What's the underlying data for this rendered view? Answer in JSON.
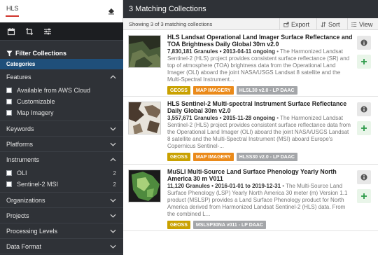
{
  "search": {
    "value": "HLS"
  },
  "filter": {
    "heading": "Filter Collections",
    "categories_label": "Categories",
    "features": {
      "label": "Features",
      "items": [
        {
          "label": "Available from AWS Cloud"
        },
        {
          "label": "Customizable"
        },
        {
          "label": "Map Imagery"
        }
      ]
    },
    "keywords_label": "Keywords",
    "platforms_label": "Platforms",
    "instruments": {
      "label": "Instruments",
      "items": [
        {
          "label": "OLI",
          "count": "2"
        },
        {
          "label": "Sentinel-2 MSI",
          "count": "2"
        }
      ]
    },
    "sections": [
      "Organizations",
      "Projects",
      "Processing Levels",
      "Data Format"
    ]
  },
  "main": {
    "title": "3 Matching Collections",
    "showing": "Showing 3 of 3 matching collections",
    "export_label": "Export",
    "sort_label": "Sort",
    "view_label": "View"
  },
  "collections": [
    {
      "title": "HLS Landsat Operational Land Imager Surface Reflectance and TOA Brightness Daily Global 30m v2.0",
      "meta": "7,830,181 Granules • 2013-04-11 ongoing",
      "desc": " • The Harmonized Landsat Sentinel-2 (HLS) project provides consistent surface reflectance (SR) and top of atmosphere (TOA) brightness data from the Operational Land Imager (OLI) aboard the joint NASA/USGS Landsat 8 satellite and the Multi-Spectral Instrument...",
      "tags": [
        "GEOSS",
        "MAP IMAGERY",
        "HLSL30 v2.0 - LP DAAC"
      ]
    },
    {
      "title": "HLS Sentinel-2 Multi-spectral Instrument Surface Reflectance Daily Global 30m v2.0",
      "meta": "3,557,671 Granules • 2015-11-28 ongoing",
      "desc": " • The Harmonized Landsat Sentinel-2 (HLS) project provides consistent surface reflectance data from the Operational Land Imager (OLI) aboard the joint NASA/USGS Landsat 8 satellite and the Multi-Spectral Instrument (MSI) aboard Europe's Copernicus Sentinel-...",
      "tags": [
        "GEOSS",
        "MAP IMAGERY",
        "HLSS30 v2.0 - LP DAAC"
      ]
    },
    {
      "title": "MuSLI Multi-Source Land Surface Phenology Yearly North America 30 m V011",
      "meta": "11,120 Granules • 2016-01-01 to 2019-12-31",
      "desc": " • The Multi-Source Land Surface Phenology (LSP) Yearly North America 30 meter (m) Version 1.1 product (MSLSP) provides a Land Surface Phenology product for North America derived from Harmonized Landsat Sentinel-2 (HLS) data. From the combined L...",
      "tags": [
        "GEOSS",
        "MSLSP30NA v011 - LP DAAC"
      ]
    }
  ],
  "colors": {
    "sidebar": "#2f3237",
    "categories": "#1f4f7a",
    "geoss": "#c9a100",
    "map_imagery": "#ea8a1a",
    "daac": "#a4a6a9",
    "add": "#2e9a4a"
  }
}
